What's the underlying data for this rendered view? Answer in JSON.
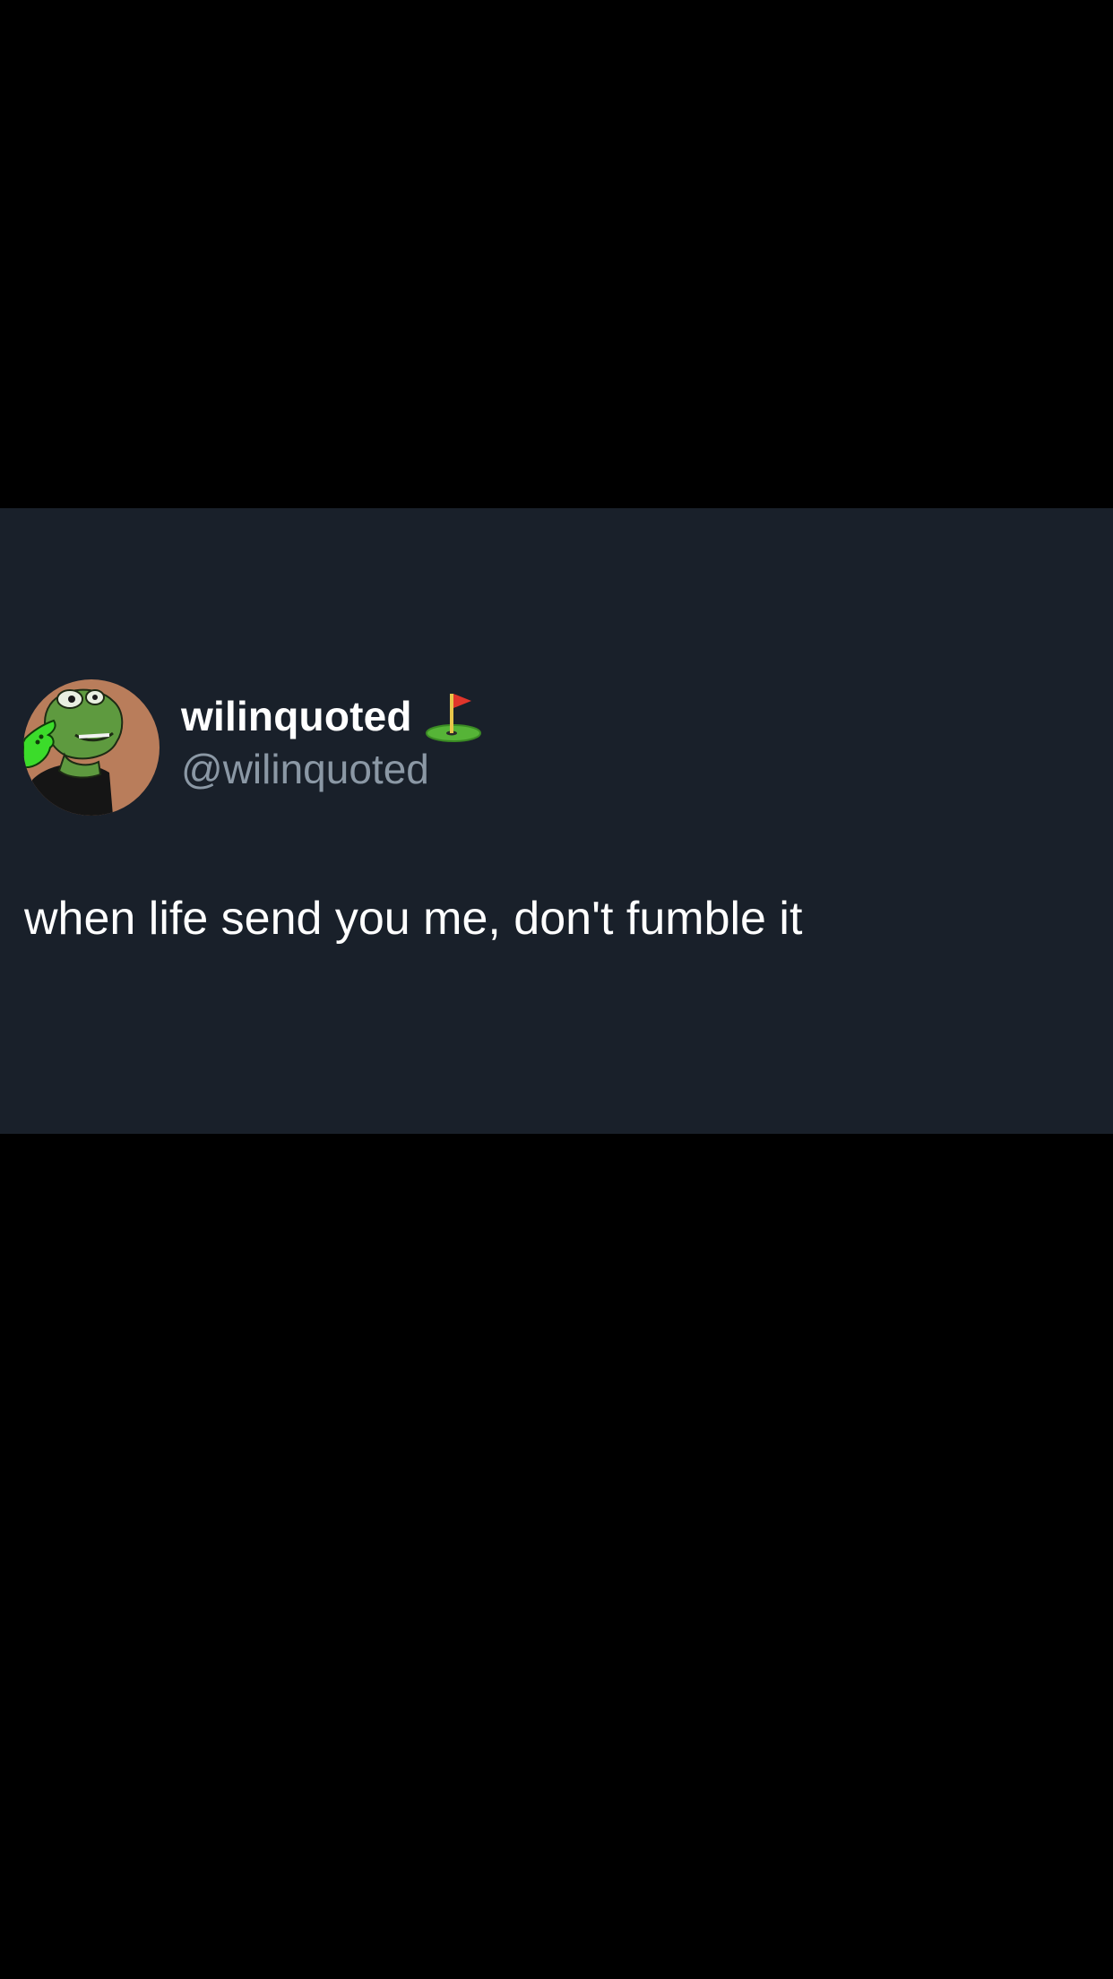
{
  "tweet": {
    "author": {
      "display_name": "wilinquoted",
      "handle": "@wilinquoted",
      "avatar": "frog-avatar",
      "name_emoji": "flag-in-hole-icon"
    },
    "text": "when life send you me, don't fumble it"
  },
  "colors": {
    "background": "#000000",
    "card_background": "#19202a",
    "text_primary": "#ffffff",
    "text_secondary": "#8b98a5"
  }
}
